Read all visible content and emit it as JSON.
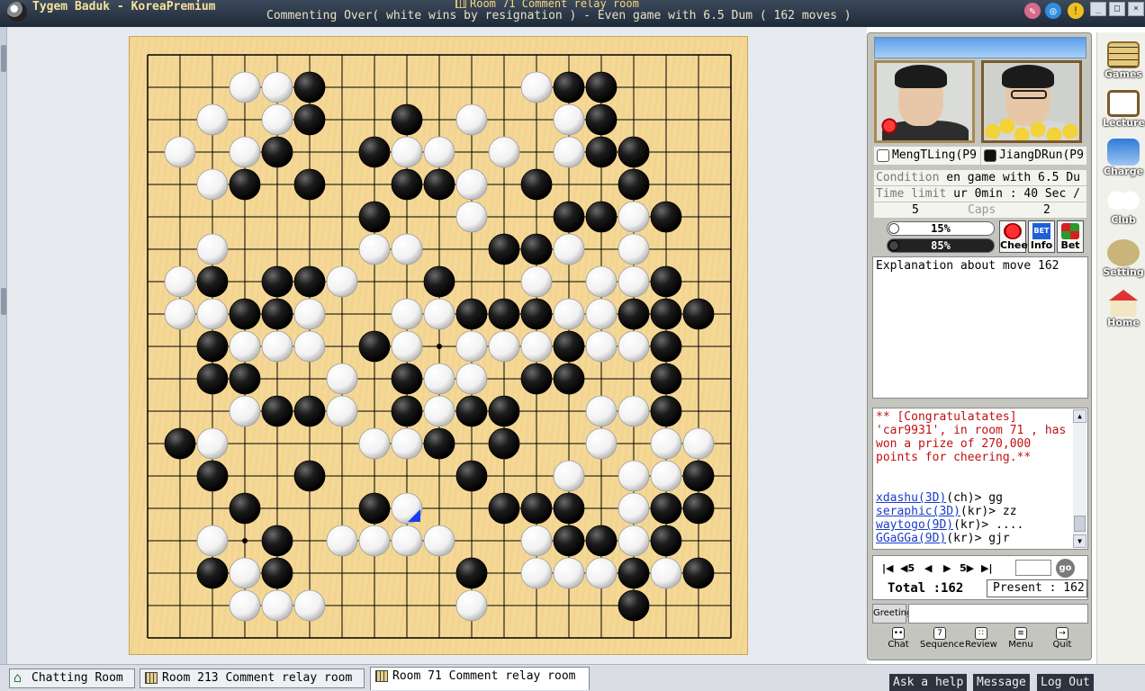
{
  "window": {
    "app_title": "Tygem Baduk - KoreaPremium",
    "room_title": "Room 71 Comment relay room",
    "game_status": "Commenting Over( white wins by resignation ) - Even game with 6.5 Dum  ( 162 moves )",
    "controls": {
      "minimize": "_",
      "maximize": "□",
      "close": "×"
    }
  },
  "board": {
    "size": 19,
    "last_move": {
      "col": 8,
      "row": 14
    },
    "black": [
      [
        5,
        1
      ],
      [
        13,
        1
      ],
      [
        14,
        1
      ],
      [
        5,
        2
      ],
      [
        8,
        2
      ],
      [
        14,
        2
      ],
      [
        4,
        3
      ],
      [
        7,
        3
      ],
      [
        14,
        3
      ],
      [
        15,
        3
      ],
      [
        3,
        4
      ],
      [
        5,
        4
      ],
      [
        8,
        4
      ],
      [
        9,
        4
      ],
      [
        12,
        4
      ],
      [
        15,
        4
      ],
      [
        7,
        5
      ],
      [
        13,
        5
      ],
      [
        14,
        5
      ],
      [
        16,
        5
      ],
      [
        11,
        6
      ],
      [
        12,
        6
      ],
      [
        2,
        7
      ],
      [
        4,
        7
      ],
      [
        5,
        7
      ],
      [
        9,
        7
      ],
      [
        16,
        7
      ],
      [
        3,
        8
      ],
      [
        4,
        8
      ],
      [
        10,
        8
      ],
      [
        11,
        8
      ],
      [
        12,
        8
      ],
      [
        15,
        8
      ],
      [
        16,
        8
      ],
      [
        17,
        8
      ],
      [
        2,
        9
      ],
      [
        7,
        9
      ],
      [
        13,
        9
      ],
      [
        16,
        9
      ],
      [
        2,
        10
      ],
      [
        3,
        10
      ],
      [
        8,
        10
      ],
      [
        12,
        10
      ],
      [
        13,
        10
      ],
      [
        16,
        10
      ],
      [
        4,
        11
      ],
      [
        5,
        11
      ],
      [
        8,
        11
      ],
      [
        10,
        11
      ],
      [
        11,
        11
      ],
      [
        16,
        11
      ],
      [
        1,
        12
      ],
      [
        9,
        12
      ],
      [
        11,
        12
      ],
      [
        2,
        13
      ],
      [
        5,
        13
      ],
      [
        10,
        13
      ],
      [
        17,
        13
      ],
      [
        3,
        14
      ],
      [
        7,
        14
      ],
      [
        11,
        14
      ],
      [
        12,
        14
      ],
      [
        13,
        14
      ],
      [
        16,
        14
      ],
      [
        17,
        14
      ],
      [
        4,
        15
      ],
      [
        13,
        15
      ],
      [
        14,
        15
      ],
      [
        16,
        15
      ],
      [
        2,
        16
      ],
      [
        4,
        16
      ],
      [
        10,
        16
      ],
      [
        15,
        16
      ],
      [
        17,
        16
      ],
      [
        15,
        17
      ]
    ],
    "white": [
      [
        3,
        1
      ],
      [
        4,
        1
      ],
      [
        12,
        1
      ],
      [
        2,
        2
      ],
      [
        4,
        2
      ],
      [
        10,
        2
      ],
      [
        13,
        2
      ],
      [
        1,
        3
      ],
      [
        3,
        3
      ],
      [
        8,
        3
      ],
      [
        9,
        3
      ],
      [
        11,
        3
      ],
      [
        13,
        3
      ],
      [
        2,
        4
      ],
      [
        10,
        4
      ],
      [
        10,
        5
      ],
      [
        15,
        5
      ],
      [
        2,
        6
      ],
      [
        7,
        6
      ],
      [
        8,
        6
      ],
      [
        13,
        6
      ],
      [
        15,
        6
      ],
      [
        1,
        7
      ],
      [
        6,
        7
      ],
      [
        12,
        7
      ],
      [
        14,
        7
      ],
      [
        15,
        7
      ],
      [
        1,
        8
      ],
      [
        2,
        8
      ],
      [
        5,
        8
      ],
      [
        8,
        8
      ],
      [
        9,
        8
      ],
      [
        13,
        8
      ],
      [
        14,
        8
      ],
      [
        3,
        9
      ],
      [
        4,
        9
      ],
      [
        5,
        9
      ],
      [
        8,
        9
      ],
      [
        10,
        9
      ],
      [
        11,
        9
      ],
      [
        12,
        9
      ],
      [
        14,
        9
      ],
      [
        15,
        9
      ],
      [
        6,
        10
      ],
      [
        9,
        10
      ],
      [
        10,
        10
      ],
      [
        3,
        11
      ],
      [
        6,
        11
      ],
      [
        9,
        11
      ],
      [
        14,
        11
      ],
      [
        15,
        11
      ],
      [
        2,
        12
      ],
      [
        7,
        12
      ],
      [
        8,
        12
      ],
      [
        14,
        12
      ],
      [
        16,
        12
      ],
      [
        17,
        12
      ],
      [
        13,
        13
      ],
      [
        15,
        13
      ],
      [
        16,
        13
      ],
      [
        8,
        14
      ],
      [
        15,
        14
      ],
      [
        2,
        15
      ],
      [
        6,
        15
      ],
      [
        7,
        15
      ],
      [
        8,
        15
      ],
      [
        9,
        15
      ],
      [
        12,
        15
      ],
      [
        15,
        15
      ],
      [
        3,
        16
      ],
      [
        12,
        16
      ],
      [
        13,
        16
      ],
      [
        14,
        16
      ],
      [
        16,
        16
      ],
      [
        3,
        17
      ],
      [
        4,
        17
      ],
      [
        5,
        17
      ],
      [
        10,
        17
      ]
    ]
  },
  "players": {
    "white_name": "MengTLing(P9",
    "black_name": "JiangDRun(P9"
  },
  "game_info": {
    "condition_label": "Condition",
    "condition_value": "en game with 6.5 Du",
    "time_label": "Time limit",
    "time_value": "ur 0min : 40 Sec /",
    "caps_label": "Caps",
    "caps_white": "5",
    "caps_black": "2",
    "white_win_pct": "15%",
    "black_win_pct": "85%",
    "white_win_fraction": 0.15,
    "black_win_fraction": 0.85
  },
  "action_buttons": {
    "cheer": "Cheer",
    "info": "Info",
    "bet": "Bet",
    "bet_icon": "BET"
  },
  "explanation": "Explanation about move 162",
  "chat": {
    "system_message": "** [Congratulatates] 'car9931', in room 71 , has won a prize of 270,000 points for cheering.**",
    "messages": [
      {
        "user": "xdashu(3D)",
        "country": "(ch)> ",
        "text": "gg"
      },
      {
        "user": "seraphic(3D)",
        "country": "(kr)> ",
        "text": "zz"
      },
      {
        "user": "waytogo(9D)",
        "country": "(kr)> ",
        "text": "...."
      },
      {
        "user": "GGaGGa(9D)",
        "country": "(kr)> ",
        "text": "gjr"
      }
    ]
  },
  "navigation": {
    "first": "|◀",
    "back5": "◀5",
    "prev": "◀",
    "next": "▶",
    "fwd5": "5▶",
    "last": "▶|",
    "go": "go",
    "total": "Total :162",
    "present": "Present : 162"
  },
  "greeting_label": "Greeting",
  "bottom_tools": {
    "chat": "Chat",
    "sequence": "Sequence",
    "review": "Review",
    "menu": "Menu",
    "quit": "Quit"
  },
  "side_toolbar": {
    "games": "Games",
    "lecture": "Lecture",
    "charge": "Charge",
    "club": "Club",
    "setting": "Setting",
    "home": "Home"
  },
  "taskbar": {
    "tabs": [
      "Chatting Room",
      "Room 213 Comment relay room",
      "Room 71 Comment relay room"
    ],
    "help": "Ask a help",
    "message": "Message",
    "logout": "Log Out"
  },
  "colors": {
    "board": "#f5d896",
    "title_bar": "#2a3545",
    "panel": "#c5c5c0",
    "last_move_marker": "#1a3cf0"
  }
}
